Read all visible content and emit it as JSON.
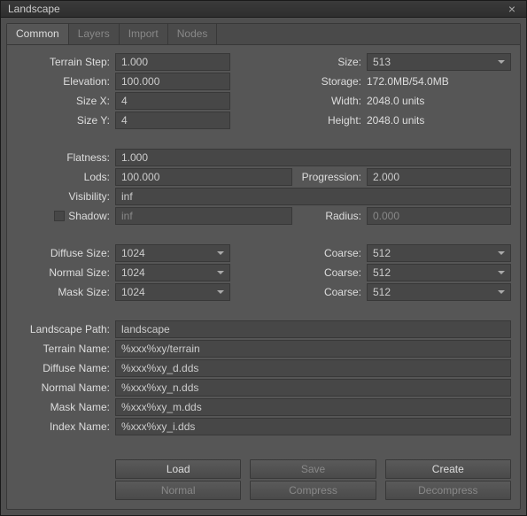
{
  "window": {
    "title": "Landscape"
  },
  "tabs": {
    "common": "Common",
    "layers": "Layers",
    "import": "Import",
    "nodes": "Nodes"
  },
  "labels": {
    "terrain_step": "Terrain Step:",
    "elevation": "Elevation:",
    "size_x": "Size X:",
    "size_y": "Size Y:",
    "size": "Size:",
    "storage": "Storage:",
    "width": "Width:",
    "height": "Height:",
    "flatness": "Flatness:",
    "lods": "Lods:",
    "progression": "Progression:",
    "visibility": "Visibility:",
    "shadow": "Shadow:",
    "radius": "Radius:",
    "diffuse_size": "Diffuse Size:",
    "normal_size": "Normal Size:",
    "mask_size": "Mask Size:",
    "coarse": "Coarse:",
    "landscape_path": "Landscape Path:",
    "terrain_name": "Terrain Name:",
    "diffuse_name": "Diffuse Name:",
    "normal_name": "Normal Name:",
    "mask_name": "Mask Name:",
    "index_name": "Index Name:"
  },
  "values": {
    "terrain_step": "1.000",
    "elevation": "100.000",
    "size_x": "4",
    "size_y": "4",
    "size": "513",
    "storage": "172.0MB/54.0MB",
    "width": "2048.0 units",
    "height": "2048.0 units",
    "flatness": "1.000",
    "lods": "100.000",
    "progression": "2.000",
    "visibility": "inf",
    "shadow": "inf",
    "radius": "0.000",
    "diffuse_size": "1024",
    "normal_size": "1024",
    "mask_size": "1024",
    "coarse1": "512",
    "coarse2": "512",
    "coarse3": "512",
    "landscape_path": "landscape",
    "terrain_name": "%xxx%xy/terrain",
    "diffuse_name": "%xxx%xy_d.dds",
    "normal_name": "%xxx%xy_n.dds",
    "mask_name": "%xxx%xy_m.dds",
    "index_name": "%xxx%xy_i.dds"
  },
  "buttons": {
    "load": "Load",
    "save": "Save",
    "create": "Create",
    "normal": "Normal",
    "compress": "Compress",
    "decompress": "Decompress"
  }
}
